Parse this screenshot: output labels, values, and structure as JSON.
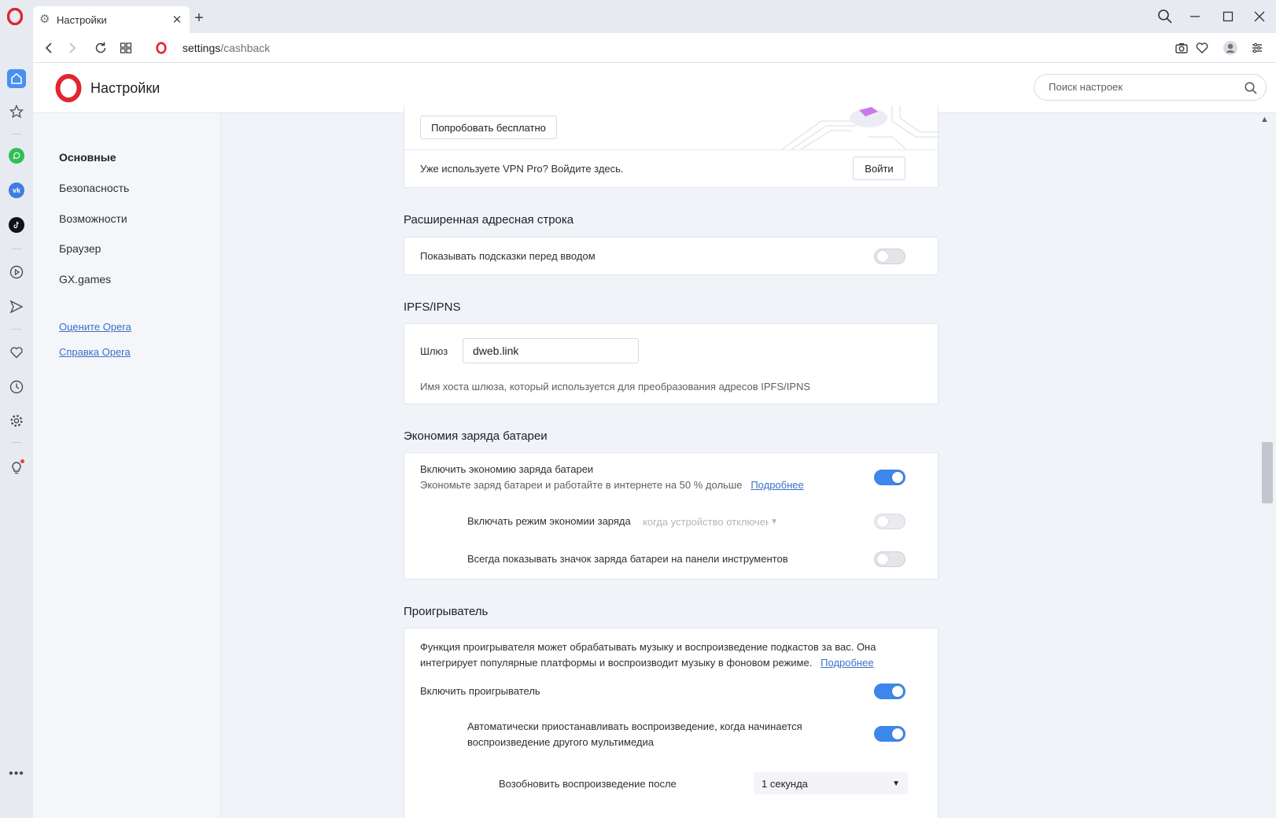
{
  "tab": {
    "title": "Настройки",
    "close": "✕",
    "new_tab": "+"
  },
  "address": {
    "host": "settings",
    "path": "/cashback"
  },
  "header": {
    "title": "Настройки",
    "search_placeholder": "Поиск настроек"
  },
  "nav": {
    "items": [
      "Основные",
      "Безопасность",
      "Возможности",
      "Браузер",
      "GX.games"
    ],
    "active": "Основные",
    "links": [
      "Оцените Opera",
      "Справка Opera"
    ]
  },
  "vpn": {
    "try_button": "Попробовать бесплатно",
    "login_text": "Уже используете VPN Pro? Войдите здесь.",
    "login_button": "Войти"
  },
  "address_bar_section": {
    "title": "Расширенная адресная строка",
    "show_suggestions": {
      "label": "Показывать подсказки перед вводом",
      "on": false
    }
  },
  "ipfs": {
    "title": "IPFS/IPNS",
    "gateway_label": "Шлюз",
    "gateway_value": "dweb.link",
    "description": "Имя хоста шлюза, который используется для преобразования адресов IPFS/IPNS"
  },
  "battery": {
    "title": "Экономия заряда батареи",
    "enable": {
      "label": "Включить экономию заряда батареи",
      "on": true
    },
    "description": "Экономьте заряд батареи и работайте в интернете на 50 % дольше",
    "more_link": "Подробнее",
    "mode": {
      "label": "Включать режим экономии заряда",
      "select_value": "когда устройство отключено",
      "on": false
    },
    "show_icon": {
      "label": "Всегда показывать значок заряда батареи на панели инструментов",
      "on": false
    }
  },
  "player": {
    "title": "Проигрыватель",
    "description_1": "Функция проигрывателя может обрабатывать музыку и воспроизведение подкастов за вас. Она",
    "description_2": "интегрирует популярные платформы и воспроизводит музыку в фоновом режиме.",
    "more_link": "Подробнее",
    "enable": {
      "label": "Включить проигрыватель",
      "on": true
    },
    "auto_pause": {
      "line1": "Автоматически приостанавливать воспроизведение, когда начинается",
      "line2": "воспроизведение другого мультимедиа",
      "on": true
    },
    "resume": {
      "label": "Возобновить воспроизведение после",
      "select_value": "1 секунда"
    }
  },
  "colors": {
    "accent": "#3d86ea",
    "opera_red": "#e0262e",
    "link": "#3a70c8"
  },
  "icons": {
    "sidebar": [
      "home-icon",
      "star-icon",
      "whatsapp-icon",
      "vk-icon",
      "tiktok-icon",
      "player-icon",
      "send-icon",
      "heart-icon",
      "history-icon",
      "settings-icon",
      "lightbulb-icon",
      "more-icon"
    ]
  }
}
